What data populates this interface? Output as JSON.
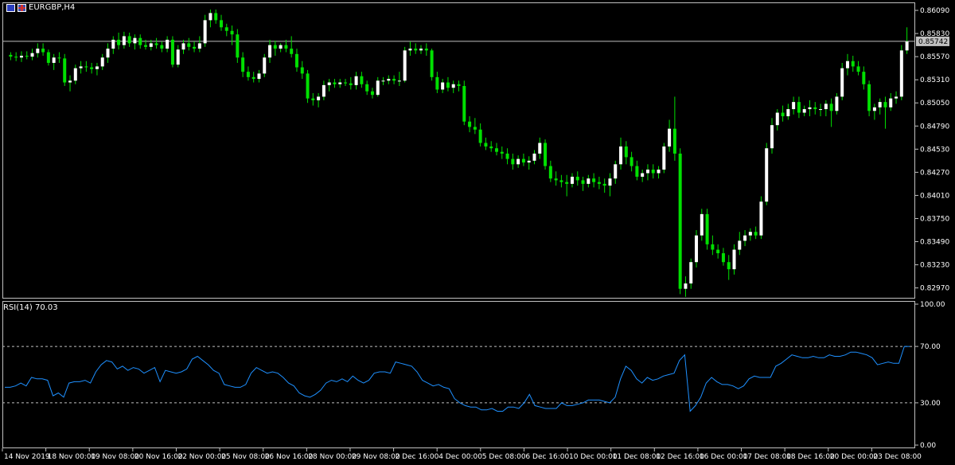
{
  "header": {
    "symbol": "EURGBP,H4"
  },
  "price_panel": {
    "current_price_label": "0.85742",
    "ticks": [
      "0.86090",
      "0.85830",
      "0.85570",
      "0.85310",
      "0.85050",
      "0.84790",
      "0.84530",
      "0.84270",
      "0.84010",
      "0.83750",
      "0.83490",
      "0.83230",
      "0.82970"
    ]
  },
  "rsi_panel": {
    "label": "RSI(14) 70.03",
    "ticks": [
      "100.00",
      "70.00",
      "30.00",
      "0.00"
    ],
    "levels": [
      70,
      30
    ]
  },
  "time_axis": [
    "14 Nov 2019",
    "18 Nov 00:00",
    "19 Nov 08:00",
    "20 Nov 16:00",
    "22 Nov 00:00",
    "25 Nov 08:00",
    "26 Nov 16:00",
    "28 Nov 00:00",
    "29 Nov 08:00",
    "2 Dec 16:00",
    "4 Dec 00:00",
    "5 Dec 08:00",
    "6 Dec 16:00",
    "10 Dec 00:00",
    "11 Dec 08:00",
    "12 Dec 16:00",
    "16 Dec 00:00",
    "17 Dec 08:00",
    "18 Dec 16:00",
    "20 Dec 00:00",
    "23 Dec 08:00"
  ],
  "colors": {
    "bull": "#ffffff",
    "bear": "#00e000",
    "wick": "#00e000",
    "rsi_line": "#1e90ff",
    "grid": "#c0c0c0",
    "price_line": "#c0c0c0"
  },
  "chart_data": [
    {
      "type": "candlestick",
      "title": "EURGBP,H4",
      "ylim": [
        0.8285,
        0.8618
      ],
      "current_price": 0.85742,
      "candles": [
        [
          0.8559,
          0.8562,
          0.8553,
          0.8557
        ],
        [
          0.8557,
          0.8562,
          0.8552,
          0.8556
        ],
        [
          0.8556,
          0.8563,
          0.8551,
          0.8558
        ],
        [
          0.8558,
          0.8563,
          0.8554,
          0.8557
        ],
        [
          0.8557,
          0.8566,
          0.8553,
          0.8561
        ],
        [
          0.8561,
          0.8572,
          0.8556,
          0.8566
        ],
        [
          0.8566,
          0.8572,
          0.8558,
          0.8562
        ],
        [
          0.8562,
          0.8565,
          0.8547,
          0.855
        ],
        [
          0.855,
          0.856,
          0.8542,
          0.8556
        ],
        [
          0.8556,
          0.8562,
          0.855,
          0.8555
        ],
        [
          0.8555,
          0.856,
          0.8524,
          0.8528
        ],
        [
          0.8528,
          0.8536,
          0.8518,
          0.853
        ],
        [
          0.853,
          0.8548,
          0.8526,
          0.8544
        ],
        [
          0.8544,
          0.8552,
          0.8538,
          0.8546
        ],
        [
          0.8546,
          0.8552,
          0.854,
          0.8545
        ],
        [
          0.8545,
          0.855,
          0.8538,
          0.8543
        ],
        [
          0.8543,
          0.855,
          0.8536,
          0.8546
        ],
        [
          0.8546,
          0.856,
          0.8542,
          0.8556
        ],
        [
          0.8556,
          0.8572,
          0.855,
          0.8566
        ],
        [
          0.8566,
          0.858,
          0.856,
          0.8576
        ],
        [
          0.8576,
          0.8584,
          0.8565,
          0.857
        ],
        [
          0.857,
          0.8585,
          0.8566,
          0.858
        ],
        [
          0.858,
          0.8584,
          0.8568,
          0.8572
        ],
        [
          0.8572,
          0.8582,
          0.8565,
          0.8578
        ],
        [
          0.8578,
          0.8582,
          0.8566,
          0.857
        ],
        [
          0.857,
          0.8576,
          0.8565,
          0.8568
        ],
        [
          0.8568,
          0.8576,
          0.8564,
          0.8572
        ],
        [
          0.8572,
          0.8578,
          0.8566,
          0.857
        ],
        [
          0.857,
          0.8574,
          0.8562,
          0.8566
        ],
        [
          0.8566,
          0.858,
          0.8562,
          0.8576
        ],
        [
          0.8576,
          0.858,
          0.8545,
          0.8548
        ],
        [
          0.8548,
          0.857,
          0.8545,
          0.8565
        ],
        [
          0.8565,
          0.8576,
          0.856,
          0.8572
        ],
        [
          0.8572,
          0.8578,
          0.8564,
          0.8568
        ],
        [
          0.8568,
          0.8574,
          0.8562,
          0.8566
        ],
        [
          0.8566,
          0.858,
          0.8562,
          0.8572
        ],
        [
          0.8572,
          0.8604,
          0.8568,
          0.8598
        ],
        [
          0.8598,
          0.861,
          0.859,
          0.8606
        ],
        [
          0.8606,
          0.861,
          0.8594,
          0.8598
        ],
        [
          0.8598,
          0.8604,
          0.8586,
          0.859
        ],
        [
          0.859,
          0.8594,
          0.858,
          0.8586
        ],
        [
          0.8586,
          0.8592,
          0.857,
          0.8582
        ],
        [
          0.8582,
          0.8588,
          0.855,
          0.8556
        ],
        [
          0.8556,
          0.8562,
          0.8534,
          0.854
        ],
        [
          0.854,
          0.8546,
          0.853,
          0.8534
        ],
        [
          0.8534,
          0.854,
          0.8528,
          0.8532
        ],
        [
          0.8532,
          0.8542,
          0.8528,
          0.8538
        ],
        [
          0.8538,
          0.856,
          0.8534,
          0.8556
        ],
        [
          0.8556,
          0.8576,
          0.855,
          0.857
        ],
        [
          0.857,
          0.8575,
          0.8558,
          0.8566
        ],
        [
          0.8566,
          0.8572,
          0.8562,
          0.857
        ],
        [
          0.857,
          0.8576,
          0.8562,
          0.8566
        ],
        [
          0.8566,
          0.858,
          0.8556,
          0.856
        ],
        [
          0.856,
          0.8566,
          0.854,
          0.8545
        ],
        [
          0.8545,
          0.8552,
          0.8532,
          0.8538
        ],
        [
          0.8538,
          0.8542,
          0.8505,
          0.851
        ],
        [
          0.851,
          0.8516,
          0.8502,
          0.8508
        ],
        [
          0.8508,
          0.8516,
          0.85,
          0.8512
        ],
        [
          0.8512,
          0.853,
          0.8508,
          0.8525
        ],
        [
          0.8525,
          0.8532,
          0.8518,
          0.8528
        ],
        [
          0.8528,
          0.8532,
          0.8522,
          0.8526
        ],
        [
          0.8526,
          0.8532,
          0.8522,
          0.8528
        ],
        [
          0.8528,
          0.8532,
          0.8524,
          0.8527
        ],
        [
          0.8527,
          0.8534,
          0.852,
          0.8525
        ],
        [
          0.8525,
          0.854,
          0.852,
          0.8535
        ],
        [
          0.8535,
          0.854,
          0.8522,
          0.8526
        ],
        [
          0.8526,
          0.853,
          0.8514,
          0.8518
        ],
        [
          0.8518,
          0.8522,
          0.851,
          0.8514
        ],
        [
          0.8514,
          0.8534,
          0.8512,
          0.853
        ],
        [
          0.853,
          0.8534,
          0.8525,
          0.853
        ],
        [
          0.853,
          0.8536,
          0.8526,
          0.8532
        ],
        [
          0.8532,
          0.8536,
          0.8526,
          0.853
        ],
        [
          0.853,
          0.854,
          0.8524,
          0.853
        ],
        [
          0.853,
          0.8568,
          0.8528,
          0.8564
        ],
        [
          0.8564,
          0.8574,
          0.8558,
          0.8566
        ],
        [
          0.8566,
          0.8572,
          0.856,
          0.8564
        ],
        [
          0.8564,
          0.857,
          0.856,
          0.8566
        ],
        [
          0.8566,
          0.8572,
          0.8558,
          0.8564
        ],
        [
          0.8564,
          0.8566,
          0.853,
          0.8534
        ],
        [
          0.8534,
          0.854,
          0.8516,
          0.852
        ],
        [
          0.852,
          0.8532,
          0.8516,
          0.8528
        ],
        [
          0.8528,
          0.8534,
          0.8518,
          0.8522
        ],
        [
          0.8522,
          0.853,
          0.8516,
          0.8526
        ],
        [
          0.8526,
          0.853,
          0.8518,
          0.8524
        ],
        [
          0.8524,
          0.853,
          0.848,
          0.8484
        ],
        [
          0.8484,
          0.849,
          0.8472,
          0.8478
        ],
        [
          0.8478,
          0.8488,
          0.847,
          0.8475
        ],
        [
          0.8475,
          0.8482,
          0.8456,
          0.846
        ],
        [
          0.846,
          0.8466,
          0.8452,
          0.8456
        ],
        [
          0.8456,
          0.8462,
          0.845,
          0.8454
        ],
        [
          0.8454,
          0.846,
          0.8446,
          0.845
        ],
        [
          0.845,
          0.8456,
          0.8442,
          0.8448
        ],
        [
          0.8448,
          0.8454,
          0.8436,
          0.8442
        ],
        [
          0.8442,
          0.8448,
          0.843,
          0.8436
        ],
        [
          0.8436,
          0.8446,
          0.8432,
          0.8442
        ],
        [
          0.8442,
          0.8448,
          0.8434,
          0.8438
        ],
        [
          0.8438,
          0.8445,
          0.843,
          0.844
        ],
        [
          0.844,
          0.8452,
          0.8436,
          0.8448
        ],
        [
          0.8448,
          0.8466,
          0.8442,
          0.846
        ],
        [
          0.846,
          0.8464,
          0.843,
          0.8434
        ],
        [
          0.8434,
          0.844,
          0.8416,
          0.842
        ],
        [
          0.842,
          0.8428,
          0.8412,
          0.8418
        ],
        [
          0.8418,
          0.8424,
          0.841,
          0.8416
        ],
        [
          0.8416,
          0.8424,
          0.84,
          0.8414
        ],
        [
          0.8414,
          0.8426,
          0.841,
          0.8422
        ],
        [
          0.8422,
          0.8428,
          0.8412,
          0.8418
        ],
        [
          0.8418,
          0.8422,
          0.8406,
          0.8414
        ],
        [
          0.8414,
          0.8424,
          0.841,
          0.842
        ],
        [
          0.842,
          0.8426,
          0.841,
          0.8416
        ],
        [
          0.8416,
          0.8422,
          0.8408,
          0.8414
        ],
        [
          0.8414,
          0.842,
          0.8404,
          0.8412
        ],
        [
          0.8412,
          0.8426,
          0.84,
          0.842
        ],
        [
          0.842,
          0.844,
          0.8414,
          0.8436
        ],
        [
          0.8436,
          0.8466,
          0.843,
          0.8456
        ],
        [
          0.8456,
          0.8462,
          0.8436,
          0.8444
        ],
        [
          0.8444,
          0.845,
          0.8428,
          0.8434
        ],
        [
          0.8434,
          0.844,
          0.8418,
          0.8422
        ],
        [
          0.8422,
          0.843,
          0.8416,
          0.8426
        ],
        [
          0.8426,
          0.8436,
          0.8418,
          0.843
        ],
        [
          0.843,
          0.8436,
          0.842,
          0.8426
        ],
        [
          0.8426,
          0.8434,
          0.842,
          0.843
        ],
        [
          0.843,
          0.846,
          0.8426,
          0.8456
        ],
        [
          0.8456,
          0.8486,
          0.845,
          0.8476
        ],
        [
          0.8476,
          0.8512,
          0.844,
          0.8448
        ],
        [
          0.8448,
          0.8454,
          0.829,
          0.8296
        ],
        [
          0.8296,
          0.831,
          0.8287,
          0.8302
        ],
        [
          0.8302,
          0.833,
          0.8296,
          0.8326
        ],
        [
          0.8326,
          0.8362,
          0.832,
          0.8356
        ],
        [
          0.8356,
          0.8386,
          0.835,
          0.838
        ],
        [
          0.838,
          0.8386,
          0.834,
          0.8346
        ],
        [
          0.8346,
          0.8356,
          0.8334,
          0.834
        ],
        [
          0.834,
          0.8346,
          0.833,
          0.8336
        ],
        [
          0.8336,
          0.8342,
          0.8322,
          0.8326
        ],
        [
          0.8326,
          0.8334,
          0.8306,
          0.8318
        ],
        [
          0.8318,
          0.8346,
          0.8312,
          0.834
        ],
        [
          0.834,
          0.836,
          0.8334,
          0.835
        ],
        [
          0.835,
          0.8362,
          0.8344,
          0.8356
        ],
        [
          0.8356,
          0.8364,
          0.835,
          0.836
        ],
        [
          0.836,
          0.8366,
          0.8352,
          0.8356
        ],
        [
          0.8356,
          0.84,
          0.8352,
          0.8394
        ],
        [
          0.8394,
          0.846,
          0.839,
          0.8454
        ],
        [
          0.8454,
          0.8488,
          0.8448,
          0.848
        ],
        [
          0.848,
          0.8498,
          0.8474,
          0.8494
        ],
        [
          0.8494,
          0.8502,
          0.8484,
          0.849
        ],
        [
          0.849,
          0.8504,
          0.8486,
          0.8498
        ],
        [
          0.8498,
          0.8512,
          0.8492,
          0.8506
        ],
        [
          0.8506,
          0.8512,
          0.8488,
          0.8494
        ],
        [
          0.8494,
          0.8502,
          0.849,
          0.8498
        ],
        [
          0.8498,
          0.8508,
          0.849,
          0.85
        ],
        [
          0.85,
          0.8506,
          0.8492,
          0.8498
        ],
        [
          0.8498,
          0.8504,
          0.849,
          0.8498
        ],
        [
          0.8498,
          0.8508,
          0.849,
          0.8504
        ],
        [
          0.8504,
          0.851,
          0.8478,
          0.8496
        ],
        [
          0.8496,
          0.8516,
          0.8492,
          0.8512
        ],
        [
          0.8512,
          0.855,
          0.8508,
          0.8544
        ],
        [
          0.8544,
          0.856,
          0.8536,
          0.8552
        ],
        [
          0.8552,
          0.8558,
          0.854,
          0.8546
        ],
        [
          0.8546,
          0.8552,
          0.8536,
          0.854
        ],
        [
          0.854,
          0.8546,
          0.852,
          0.8526
        ],
        [
          0.8526,
          0.853,
          0.849,
          0.8496
        ],
        [
          0.8496,
          0.8504,
          0.8486,
          0.85
        ],
        [
          0.85,
          0.851,
          0.8492,
          0.8506
        ],
        [
          0.8506,
          0.8512,
          0.8476,
          0.85
        ],
        [
          0.85,
          0.8516,
          0.8496,
          0.851
        ],
        [
          0.851,
          0.8518,
          0.8504,
          0.8512
        ],
        [
          0.8512,
          0.857,
          0.8508,
          0.8564
        ],
        [
          0.8564,
          0.859,
          0.856,
          0.8574
        ]
      ]
    },
    {
      "type": "line",
      "title": "RSI(14) 70.03",
      "ylim": [
        0,
        100
      ],
      "series": [
        {
          "values": [
            41,
            41,
            42,
            44,
            42,
            48,
            47,
            47,
            46,
            35,
            37,
            34,
            44,
            45,
            45,
            46,
            44,
            52,
            57,
            60,
            59,
            54,
            56,
            53,
            55,
            54,
            51,
            53,
            55,
            45,
            53,
            52,
            51,
            52,
            54,
            61,
            63,
            60,
            57,
            53,
            51,
            43,
            42,
            41,
            41,
            43,
            51,
            55,
            53,
            51,
            52,
            51,
            48,
            44,
            42,
            37,
            35,
            34,
            36,
            39,
            44,
            46,
            45,
            47,
            45,
            49,
            46,
            44,
            46,
            51,
            52,
            52,
            51,
            59,
            58,
            57,
            56,
            52,
            46,
            44,
            42,
            43,
            41,
            40,
            33,
            30,
            28,
            27,
            27,
            25,
            25,
            26,
            24,
            24,
            27,
            27,
            26,
            30,
            36,
            28,
            27,
            26,
            26,
            26,
            30,
            28,
            28,
            29,
            30,
            32,
            32,
            32,
            31,
            30,
            34,
            47,
            56,
            53,
            47,
            44,
            48,
            46,
            47,
            49,
            50,
            51,
            60,
            64,
            24,
            28,
            34,
            44,
            48,
            45,
            43,
            43,
            42,
            40,
            42,
            47,
            49,
            48,
            48,
            48,
            56,
            58,
            61,
            64,
            63,
            62,
            62,
            63,
            62,
            62,
            64,
            63,
            63,
            64,
            66,
            66,
            65,
            64,
            62,
            57,
            58,
            59,
            58,
            58,
            70,
            70
          ]
        }
      ]
    }
  ]
}
